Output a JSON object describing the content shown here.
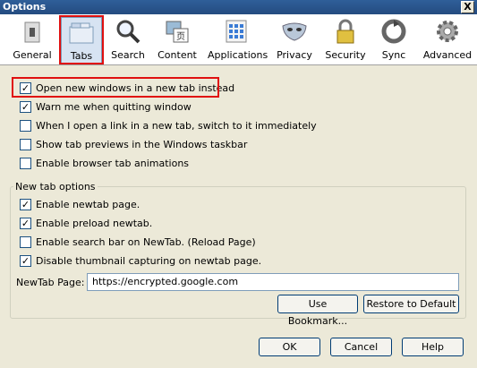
{
  "window": {
    "title": "Options",
    "close_label": "X"
  },
  "toolbar": {
    "items": [
      {
        "label": "General",
        "icon": "switch-icon"
      },
      {
        "label": "Tabs",
        "icon": "tabs-icon",
        "selected": true
      },
      {
        "label": "Search",
        "icon": "magnifier-icon"
      },
      {
        "label": "Content",
        "icon": "content-icon"
      },
      {
        "label": "Applications",
        "icon": "applications-icon"
      },
      {
        "label": "Privacy",
        "icon": "mask-icon"
      },
      {
        "label": "Security",
        "icon": "lock-icon"
      },
      {
        "label": "Sync",
        "icon": "sync-icon"
      },
      {
        "label": "Advanced",
        "icon": "gear-icon"
      }
    ]
  },
  "tab_options": [
    {
      "label": "Open new windows in a new tab instead",
      "checked": true
    },
    {
      "label": "Warn me when quitting window",
      "checked": true
    },
    {
      "label": "When I open a link in a new tab, switch to it immediately",
      "checked": false
    },
    {
      "label": "Show tab previews in the Windows taskbar",
      "checked": false
    },
    {
      "label": "Enable browser tab animations",
      "checked": false
    }
  ],
  "newtab_group": {
    "title": "New tab options",
    "options": [
      {
        "label": "Enable newtab page.",
        "checked": true
      },
      {
        "label": "Enable preload newtab.",
        "checked": true
      },
      {
        "label": "Enable search bar on NewTab. (Reload Page)",
        "checked": false
      },
      {
        "label": "Disable thumbnail capturing on newtab page.",
        "checked": true
      }
    ],
    "page_label": "NewTab Page:",
    "page_value": "https://encrypted.google.com",
    "use_bookmark_label": "Use Bookmark...",
    "restore_default_label": "Restore to Default"
  },
  "footer": {
    "ok_label": "OK",
    "cancel_label": "Cancel",
    "help_label": "Help"
  },
  "colors": {
    "titlebar": "#2f5f99",
    "highlight": "#e01010",
    "dialog_bg": "#ece9d8"
  }
}
